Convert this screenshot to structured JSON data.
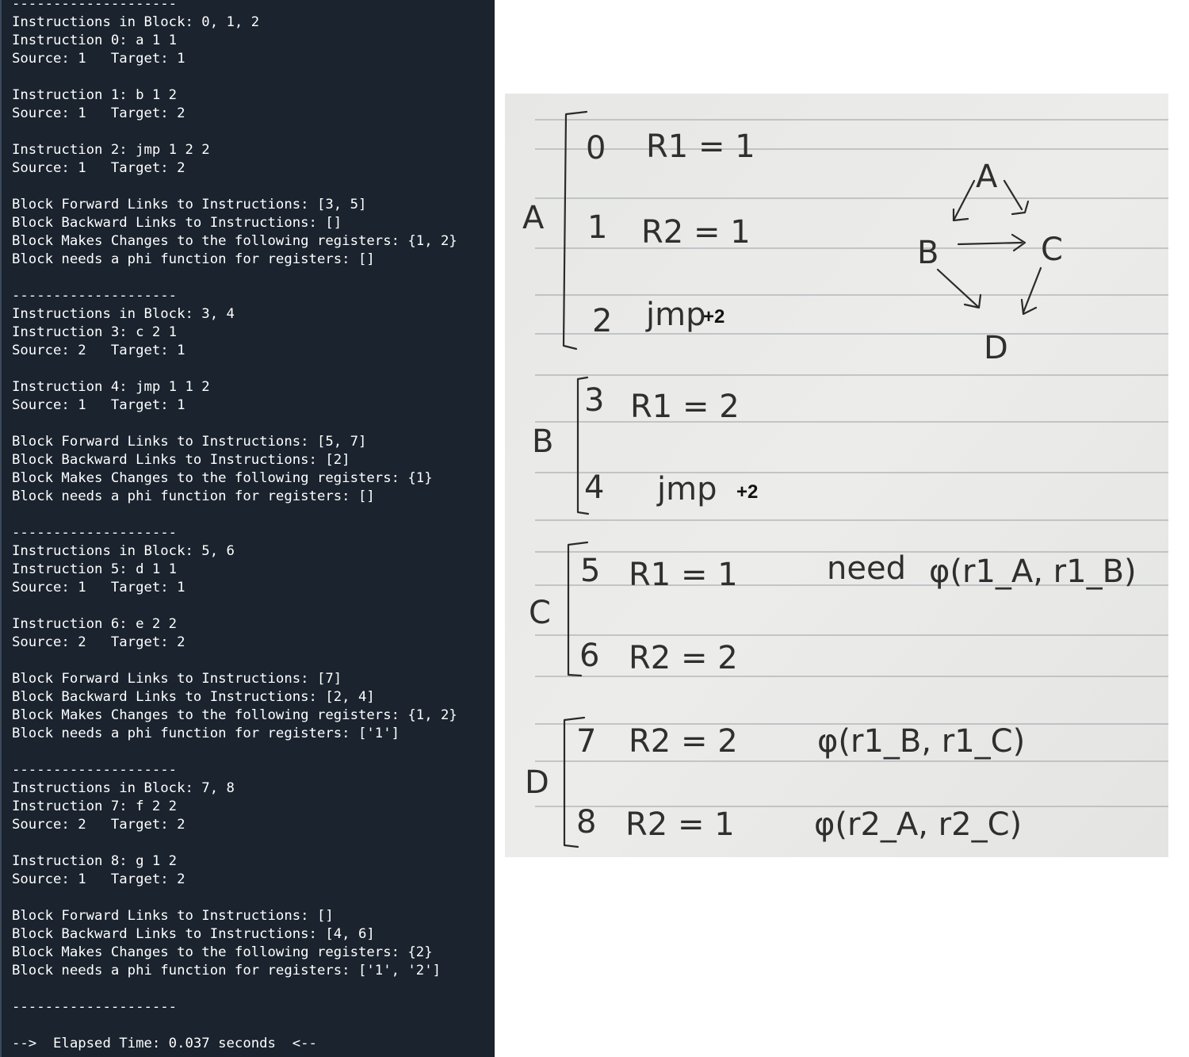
{
  "terminal": {
    "lines": [
      "--------------------",
      "Instructions in Block: 0, 1, 2",
      "Instruction 0: a 1 1",
      "Source: 1   Target: 1",
      "",
      "Instruction 1: b 1 2",
      "Source: 1   Target: 2",
      "",
      "Instruction 2: jmp 1 2 2",
      "Source: 1   Target: 2",
      "",
      "Block Forward Links to Instructions: [3, 5]",
      "Block Backward Links to Instructions: []",
      "Block Makes Changes to the following registers: {1, 2}",
      "Block needs a phi function for registers: []",
      "",
      "--------------------",
      "Instructions in Block: 3, 4",
      "Instruction 3: c 2 1",
      "Source: 2   Target: 1",
      "",
      "Instruction 4: jmp 1 1 2",
      "Source: 1   Target: 1",
      "",
      "Block Forward Links to Instructions: [5, 7]",
      "Block Backward Links to Instructions: [2]",
      "Block Makes Changes to the following registers: {1}",
      "Block needs a phi function for registers: []",
      "",
      "--------------------",
      "Instructions in Block: 5, 6",
      "Instruction 5: d 1 1",
      "Source: 1   Target: 1",
      "",
      "Instruction 6: e 2 2",
      "Source: 2   Target: 2",
      "",
      "Block Forward Links to Instructions: [7]",
      "Block Backward Links to Instructions: [2, 4]",
      "Block Makes Changes to the following registers: {1, 2}",
      "Block needs a phi function for registers: ['1']",
      "",
      "--------------------",
      "Instructions in Block: 7, 8",
      "Instruction 7: f 2 2",
      "Source: 2   Target: 2",
      "",
      "Instruction 8: g 1 2",
      "Source: 1   Target: 2",
      "",
      "Block Forward Links to Instructions: []",
      "Block Backward Links to Instructions: [4, 6]",
      "Block Makes Changes to the following registers: {2}",
      "Block needs a phi function for registers: ['1', '2']",
      "",
      "--------------------",
      "",
      "-->  Elapsed Time: 0.037 seconds  <--"
    ]
  },
  "notes": {
    "block_a_label": "A",
    "block_b_label": "B",
    "block_c_label": "C",
    "block_d_label": "D",
    "rows": [
      {
        "num": "0",
        "code": "R1 = 1",
        "extra": ""
      },
      {
        "num": "1",
        "code": "R2 = 1",
        "extra": ""
      },
      {
        "num": "2",
        "code": "jmp",
        "extra": "+2"
      },
      {
        "num": "3",
        "code": "R1 = 2",
        "extra": ""
      },
      {
        "num": "4",
        "code": "jmp",
        "extra": "+2"
      },
      {
        "num": "5",
        "code": "R1 = 1",
        "extra": ""
      },
      {
        "num": "6",
        "code": "R2 = 2",
        "extra": ""
      },
      {
        "num": "7",
        "code": "R2 = 2",
        "extra": ""
      },
      {
        "num": "8",
        "code": "R2 = 1",
        "extra": ""
      }
    ],
    "c_note_word": "need",
    "c_note_phi": "φ(r1_A, r1_B)",
    "d_note_phi_1": "φ(r1_B, r1_C)",
    "d_note_phi_2": "φ(r2_A, r2_C)",
    "graph_nodes": {
      "a": "A",
      "b": "B",
      "c": "C",
      "d": "D"
    }
  }
}
